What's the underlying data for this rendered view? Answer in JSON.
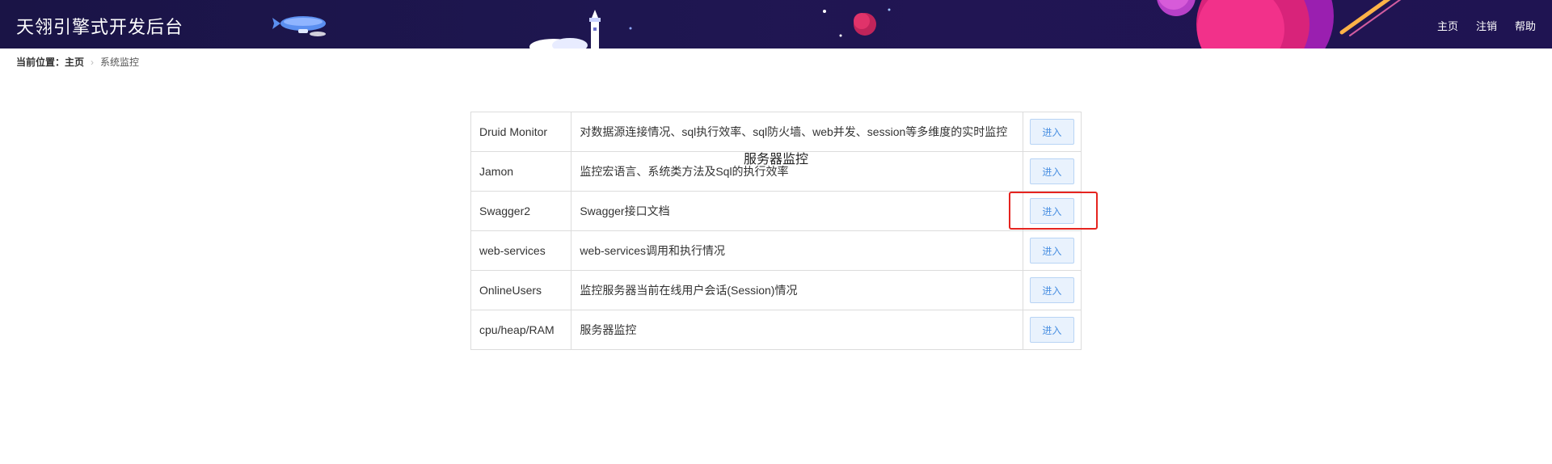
{
  "header": {
    "title": "天翎引擎式开发后台",
    "nav": [
      {
        "label": "主页"
      },
      {
        "label": "注销"
      },
      {
        "label": "帮助"
      }
    ]
  },
  "breadcrumb": {
    "lead": "当前位置：",
    "home": "主页",
    "current": "系统监控"
  },
  "section": {
    "title": "服务器监控"
  },
  "rows": [
    {
      "name": "Druid Monitor",
      "desc": "对数据源连接情况、sql执行效率、sql防火墙、web并发、session等多维度的实时监控",
      "action": "进入"
    },
    {
      "name": "Jamon",
      "desc": "监控宏语言、系统类方法及Sql的执行效率",
      "action": "进入"
    },
    {
      "name": "Swagger2",
      "desc": "Swagger接口文档",
      "action": "进入"
    },
    {
      "name": "web-services",
      "desc": "web-services调用和执行情况",
      "action": "进入"
    },
    {
      "name": "OnlineUsers",
      "desc": "监控服务器当前在线用户会话(Session)情况",
      "action": "进入"
    },
    {
      "name": "cpu/heap/RAM",
      "desc": "服务器监控",
      "action": "进入"
    }
  ],
  "colors": {
    "header_bg": "#1e1650",
    "button_bg": "#e9f2fd",
    "button_text": "#4a90e2",
    "highlight": "#e5241f"
  }
}
